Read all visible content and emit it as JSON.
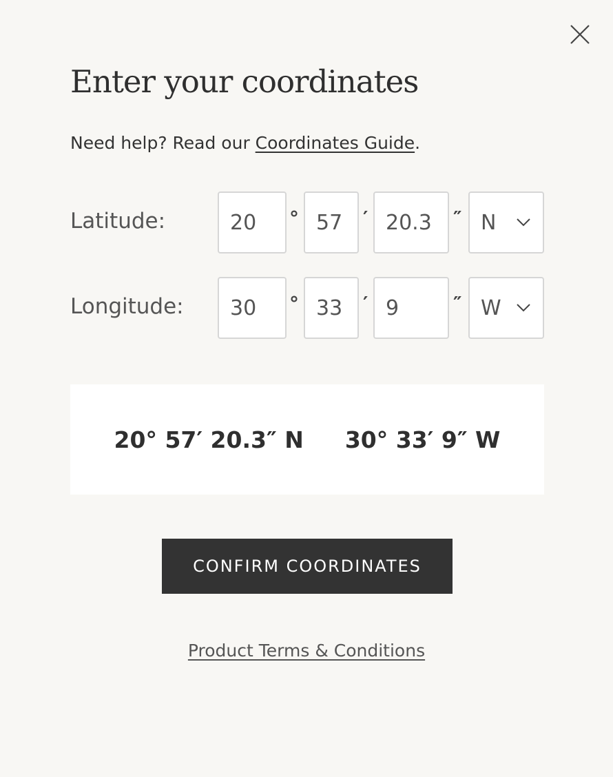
{
  "dialog": {
    "title": "Enter your coordinates",
    "help_prefix": "Need help? Read our ",
    "help_link": "Coordinates Guide",
    "help_suffix": "."
  },
  "latitude": {
    "label": "Latitude:",
    "degrees": "20",
    "minutes": "57",
    "seconds": "20.3",
    "direction": "N"
  },
  "longitude": {
    "label": "Longitude:",
    "degrees": "30",
    "minutes": "33",
    "seconds": "9",
    "direction": "W"
  },
  "units": {
    "degree": "°",
    "minute": "′",
    "second": "″"
  },
  "preview": {
    "latitude": "20° 57′ 20.3″ N",
    "longitude": "30° 33′ 9″ W"
  },
  "actions": {
    "confirm_label": "CONFIRM COORDINATES",
    "terms_label": "Product Terms & Conditions"
  },
  "icons": {
    "close": "close-icon",
    "dropdown": "chevron-down-icon"
  },
  "colors": {
    "background": "#f8f7f4",
    "button": "#333333",
    "text": "#333333"
  }
}
